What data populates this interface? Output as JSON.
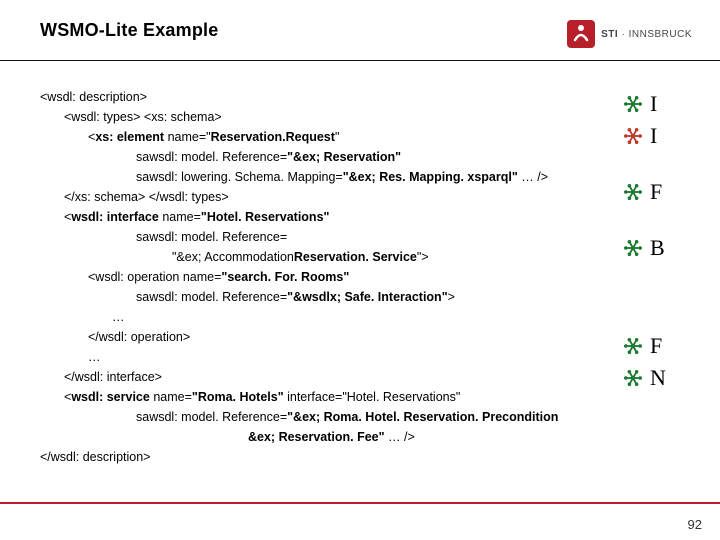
{
  "header": {
    "title": "WSMO-Lite Example",
    "brand_logo_name": "sti-logo",
    "brand": "STI",
    "brand_sep": "·",
    "brand_sub": "INNSBRUCK"
  },
  "code": {
    "l1": "<wsdl: description>",
    "l2": "<wsdl: types>   <xs: schema>",
    "l3a": "<",
    "l3b": "xs: element",
    "l3c": " name=\"",
    "l3d": "Reservation.Request",
    "l3e": "\"",
    "l4": "sawsdl: model. Reference=",
    "l4q": "\"&ex; Reservation\"",
    "l5": "sawsdl: lowering. Schema. Mapping=",
    "l5q": "\"&ex; Res. Mapping. xsparql\"",
    "l5t": " … />",
    "l6": "</xs: schema>   </wsdl: types>",
    "l7a": "<",
    "l7b": "wsdl: interface   ",
    "l7c": "name=",
    "l7d": "\"Hotel. Reservations\"",
    "l8": "sawsdl: model. Reference=",
    "l9a": "\"&ex; Accommodation",
    "l9b": "Reservation. Service",
    "l9c": "\">",
    "l10a": "<wsdl: operation name=",
    "l10b": "\"search. For. Rooms\"",
    "l11": "sawsdl: model. Reference=",
    "l11q": "\"&wsdlx; Safe. Interaction\"",
    "l11t": ">",
    "l12": "…",
    "l13": "</wsdl: operation>",
    "l14": "…",
    "l15": "</wsdl: interface>",
    "l16a": "<",
    "l16b": "wsdl: service   ",
    "l16c": "name=",
    "l16d": "\"Roma. Hotels\"",
    "l16e": "   interface=\"Hotel. Reservations\"",
    "l17": "sawsdl: model. Reference=",
    "l17q": "\"&ex; Roma. Hotel. Reservation. Precondition",
    "l18q": "&ex; Reservation. Fee\"",
    "l18t": "  … />",
    "l19": "</wsdl: description>"
  },
  "sidebar": [
    {
      "color": "#1a7a2e",
      "letter": "I"
    },
    {
      "color": "#c0392b",
      "letter": "I"
    },
    {
      "spacer": true
    },
    {
      "color": "#1a7a2e",
      "letter": "F"
    },
    {
      "spacer": true
    },
    {
      "color": "#1a7a2e",
      "letter": "B"
    },
    {
      "spacerL": true
    },
    {
      "color": "#1a7a2e",
      "letter": "F"
    },
    {
      "color": "#1a7a2e",
      "letter": "N"
    }
  ],
  "footer": {
    "page": "92"
  }
}
